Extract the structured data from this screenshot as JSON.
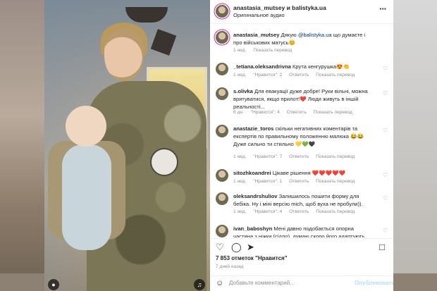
{
  "header": {
    "username": "anastasia_mutsey и balistyka.ua",
    "audio": "Оригинальное аудио",
    "more_icon": "more-horizontal-icon"
  },
  "caption": {
    "user": "anastasia_mutsey",
    "text_before": " Дякую ",
    "mention": "@balistyka.ua",
    "text_after": " що думаєте і про військових матусь😊",
    "time": "1 нед.",
    "translate": "Показать перевод"
  },
  "comments": [
    {
      "user": "_tetiana.oleksandrivna",
      "text": " Крута кенгурушка😍👏",
      "time": "1 нед.",
      "likes": "\"Нравится\": 2",
      "reply": "Ответить",
      "translate": "Показать перевод"
    },
    {
      "user": "s.olivka",
      "text": " Для евакуації дуже добре! Руки вільні, можна врятуватися, якщо прилот!❤️ Люди живуть в іншій реальності...",
      "time": "6 дн.",
      "likes": "\"Нравится\": 4",
      "reply": "Ответить",
      "translate": "Показать перевод"
    },
    {
      "user": "anastazie_toros",
      "text": " скільки негативних коментарів та експертів по правильному положенню малюка 😂😂  Дуже сильно ти стильно 💛💚🖤",
      "time": "1 нед.",
      "likes": "\"Нравится\": 7",
      "reply": "Ответить",
      "translate": "Показать перевод"
    },
    {
      "user": "sitozhkoandrei",
      "text": " Цікаве рішення ❤️❤️❤️❤️❤️",
      "time": "1 нед.",
      "likes": "\"Нравится\": 1",
      "reply": "Ответить",
      "translate": "Показать перевод"
    },
    {
      "user": "oleksandrshuliov",
      "text": " Залишилось пошити форму для бебіка. Ну і міні версію mich, щоб вуха не пробули)).",
      "time": "1 нед.",
      "likes": "\"Нравится\": 4",
      "reply": "Ответить",
      "translate": "Показать перевод"
    },
    {
      "user": "ivan_baboshyn",
      "text": " Мені давно подобається опорна частина з ніжки (сідло), думаю скоро його адаптують для",
      "time": "",
      "likes": "",
      "reply": "",
      "translate": ""
    }
  ],
  "actions": {
    "like_icon": "heart-icon",
    "comment_icon": "comment-icon",
    "share_icon": "share-icon",
    "save_icon": "bookmark-icon"
  },
  "likes_count": "7 853 отметок \"Нравится\"",
  "posted_ago": "7 дней назад",
  "composer": {
    "emoji_icon": "emoji-icon",
    "placeholder": "Добавьте комментарий...",
    "publish": "Опубликовать"
  },
  "colors": {
    "accent_link": "#00376b",
    "muted": "#8e8e8e",
    "publish_disabled": "#b2dffc"
  }
}
